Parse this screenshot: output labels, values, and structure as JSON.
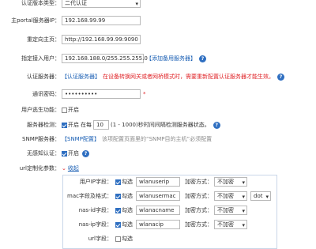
{
  "auth_type": {
    "label": "认证版本类型：",
    "value": "二代认证"
  },
  "portal_ip": {
    "label": "主portal服务器IP：",
    "value": "192.168.99.99"
  },
  "redirect_home": {
    "label": "重定向主页：",
    "value": "http://192.168.99.99:9090"
  },
  "access_user": {
    "label": "指定接入用户：",
    "value": "192.168.188.0/255.255.255.0",
    "add_link": "【添加备用服务器】"
  },
  "auth_server": {
    "label": "认证服务器：",
    "link": "【认证服务器】",
    "note": "在设备转换网关或者网桥模式时，需要重新配置认证服务器才能生效。"
  },
  "password": {
    "label": "通讯密码：",
    "value": "••••••••••",
    "required": "*"
  },
  "user_escape": {
    "label": "用户逃生功能：",
    "checkbox": "开启"
  },
  "server_check": {
    "label": "服务器检测：",
    "checkbox": "开启",
    "prefix": "在每",
    "interval": "10",
    "suffix": "(1 - 1000)秒时间间隔检测服务器状态。"
  },
  "snmp": {
    "label": "SNMP服务器：",
    "link": "【SNMP配置】",
    "note": "该项配置页面里的“SNMP目的主机”必须配置"
  },
  "no_auth": {
    "label": "无感知认证：",
    "checkbox": "开启"
  },
  "url_custom": {
    "label": "url定制化参数：",
    "link": "收起"
  },
  "params": [
    {
      "label": "用户IP字段：",
      "checkbox": "勾选",
      "value": "wlanuserip",
      "enc_label": "加密方式：",
      "enc": "不加密"
    },
    {
      "label": "mac字段及格式：",
      "checkbox": "勾选",
      "value": "wlanusermac",
      "enc_label": "加密方式：",
      "enc": "不加密",
      "sep": "dot"
    },
    {
      "label": "nas-id字段：",
      "checkbox": "勾选",
      "value": "wlanacname",
      "enc_label": "加密方式：",
      "enc": "不加密"
    },
    {
      "label": "nas-ip字段：",
      "checkbox": "勾选",
      "value": "wlanacip",
      "enc_label": "加密方式：",
      "enc": "不加密"
    },
    {
      "label": "url字段：",
      "checkbox": "勾选"
    }
  ],
  "icons": {
    "help": "question-circle-icon",
    "dropdown": "chevron-down-icon"
  },
  "colors": {
    "link": "#1a5fb4",
    "warning": "#e0262a",
    "accent": "#2f6fc1"
  }
}
